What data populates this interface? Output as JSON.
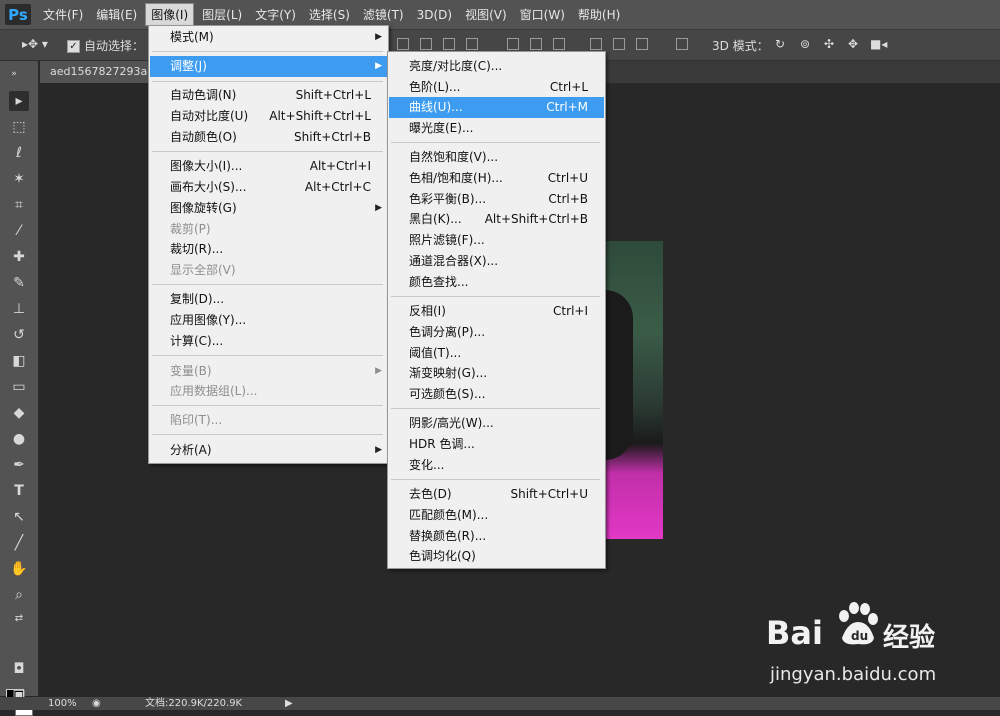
{
  "app": {
    "logo": "Ps"
  },
  "menubar": [
    {
      "label": "文件(F)"
    },
    {
      "label": "编辑(E)"
    },
    {
      "label": "图像(I)"
    },
    {
      "label": "图层(L)"
    },
    {
      "label": "文字(Y)"
    },
    {
      "label": "选择(S)"
    },
    {
      "label": "滤镜(T)"
    },
    {
      "label": "3D(D)"
    },
    {
      "label": "视图(V)"
    },
    {
      "label": "窗口(W)"
    },
    {
      "label": "帮助(H)"
    }
  ],
  "options": {
    "auto_select": "自动选择：",
    "mode3d": "3D 模式："
  },
  "document": {
    "tab": "aed1567827293a4"
  },
  "status": {
    "zoom": "100%",
    "docinfo": "文档:220.9K/220.9K"
  },
  "image_menu": [
    {
      "label": "模式(M)",
      "shortcut": "",
      "submenu": true
    },
    {
      "label": "调整(J)",
      "shortcut": "",
      "submenu": true,
      "highlighted": true
    },
    {
      "label": "自动色调(N)",
      "shortcut": "Shift+Ctrl+L"
    },
    {
      "label": "自动对比度(U)",
      "shortcut": "Alt+Shift+Ctrl+L"
    },
    {
      "label": "自动颜色(O)",
      "shortcut": "Shift+Ctrl+B"
    },
    {
      "label": "图像大小(I)...",
      "shortcut": "Alt+Ctrl+I"
    },
    {
      "label": "画布大小(S)...",
      "shortcut": "Alt+Ctrl+C"
    },
    {
      "label": "图像旋转(G)",
      "shortcut": "",
      "submenu": true
    },
    {
      "label": "裁剪(P)",
      "shortcut": "",
      "disabled": true
    },
    {
      "label": "裁切(R)...",
      "shortcut": ""
    },
    {
      "label": "显示全部(V)",
      "shortcut": "",
      "disabled": true
    },
    {
      "label": "复制(D)...",
      "shortcut": ""
    },
    {
      "label": "应用图像(Y)...",
      "shortcut": ""
    },
    {
      "label": "计算(C)...",
      "shortcut": ""
    },
    {
      "label": "变量(B)",
      "shortcut": "",
      "submenu": true,
      "disabled": true
    },
    {
      "label": "应用数据组(L)...",
      "shortcut": "",
      "disabled": true
    },
    {
      "label": "陷印(T)...",
      "shortcut": "",
      "disabled": true
    },
    {
      "label": "分析(A)",
      "shortcut": "",
      "submenu": true
    }
  ],
  "adjust_menu": [
    {
      "label": "亮度/对比度(C)...",
      "shortcut": ""
    },
    {
      "label": "色阶(L)...",
      "shortcut": "Ctrl+L"
    },
    {
      "label": "曲线(U)...",
      "shortcut": "Ctrl+M",
      "highlighted": true
    },
    {
      "label": "曝光度(E)...",
      "shortcut": ""
    },
    {
      "label": "自然饱和度(V)...",
      "shortcut": ""
    },
    {
      "label": "色相/饱和度(H)...",
      "shortcut": "Ctrl+U"
    },
    {
      "label": "色彩平衡(B)...",
      "shortcut": "Ctrl+B"
    },
    {
      "label": "黑白(K)...",
      "shortcut": "Alt+Shift+Ctrl+B"
    },
    {
      "label": "照片滤镜(F)...",
      "shortcut": ""
    },
    {
      "label": "通道混合器(X)...",
      "shortcut": ""
    },
    {
      "label": "颜色查找...",
      "shortcut": ""
    },
    {
      "label": "反相(I)",
      "shortcut": "Ctrl+I"
    },
    {
      "label": "色调分离(P)...",
      "shortcut": ""
    },
    {
      "label": "阈值(T)...",
      "shortcut": ""
    },
    {
      "label": "渐变映射(G)...",
      "shortcut": ""
    },
    {
      "label": "可选颜色(S)...",
      "shortcut": ""
    },
    {
      "label": "阴影/高光(W)...",
      "shortcut": ""
    },
    {
      "label": "HDR 色调...",
      "shortcut": ""
    },
    {
      "label": "变化...",
      "shortcut": ""
    },
    {
      "label": "去色(D)",
      "shortcut": "Shift+Ctrl+U"
    },
    {
      "label": "匹配颜色(M)...",
      "shortcut": ""
    },
    {
      "label": "替换颜色(R)...",
      "shortcut": ""
    },
    {
      "label": "色调均化(Q)",
      "shortcut": ""
    }
  ],
  "watermark": {
    "brand": "Bai",
    "brand2": "du",
    "jingyan": "经验",
    "url": "jingyan.baidu.com"
  }
}
